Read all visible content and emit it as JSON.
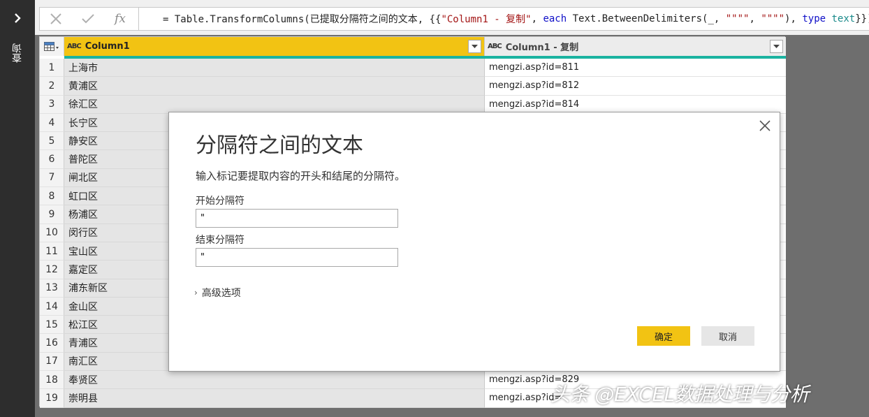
{
  "rail": {
    "label": "查询"
  },
  "formula": {
    "tokens": [
      {
        "t": "= Table.TransformColumns(已提取分隔符之间的文本, {{",
        "c": ""
      },
      {
        "t": "\"Column1 - 复制\"",
        "c": "str"
      },
      {
        "t": ", ",
        "c": ""
      },
      {
        "t": "each",
        "c": "kw"
      },
      {
        "t": " Text.BetweenDelimiters(_, ",
        "c": ""
      },
      {
        "t": "\"\"\"\"",
        "c": "str"
      },
      {
        "t": ", ",
        "c": ""
      },
      {
        "t": "\"\"\"\"",
        "c": "str"
      },
      {
        "t": "), ",
        "c": ""
      },
      {
        "t": "type",
        "c": "kw"
      },
      {
        "t": " ",
        "c": ""
      },
      {
        "t": "text",
        "c": "type"
      },
      {
        "t": "}})",
        "c": ""
      }
    ]
  },
  "grid": {
    "type_icon": "ABC",
    "columns": [
      "Column1",
      "Column1 - 复制"
    ],
    "rows": [
      {
        "n": "1",
        "c1": "上海市",
        "c2": "mengzi.asp?id=811"
      },
      {
        "n": "2",
        "c1": "黄浦区",
        "c2": "mengzi.asp?id=812"
      },
      {
        "n": "3",
        "c1": "徐汇区",
        "c2": "mengzi.asp?id=814"
      },
      {
        "n": "4",
        "c1": "长宁区",
        "c2": ""
      },
      {
        "n": "5",
        "c1": "静安区",
        "c2": ""
      },
      {
        "n": "6",
        "c1": "普陀区",
        "c2": ""
      },
      {
        "n": "7",
        "c1": "闸北区",
        "c2": ""
      },
      {
        "n": "8",
        "c1": "虹口区",
        "c2": ""
      },
      {
        "n": "9",
        "c1": "杨浦区",
        "c2": ""
      },
      {
        "n": "10",
        "c1": "闵行区",
        "c2": ""
      },
      {
        "n": "11",
        "c1": "宝山区",
        "c2": ""
      },
      {
        "n": "12",
        "c1": "嘉定区",
        "c2": ""
      },
      {
        "n": "13",
        "c1": "浦东新区",
        "c2": ""
      },
      {
        "n": "14",
        "c1": "金山区",
        "c2": ""
      },
      {
        "n": "15",
        "c1": "松江区",
        "c2": ""
      },
      {
        "n": "16",
        "c1": "青浦区",
        "c2": ""
      },
      {
        "n": "17",
        "c1": "南汇区",
        "c2": ""
      },
      {
        "n": "18",
        "c1": "奉贤区",
        "c2": "mengzi.asp?id=829"
      },
      {
        "n": "19",
        "c1": "崇明县",
        "c2": "mengzi.asp?id="
      }
    ]
  },
  "dialog": {
    "title": "分隔符之间的文本",
    "description": "输入标记要提取内容的开头和结尾的分隔符。",
    "start_label": "开始分隔符",
    "start_value": "\"",
    "end_label": "结束分隔符",
    "end_value": "\"",
    "advanced_label": "高级选项",
    "ok_label": "确定",
    "cancel_label": "取消"
  },
  "watermark": "头条 @EXCEL数据处理与分析",
  "colors": {
    "accent": "#f2c313",
    "teal": "#1bb3a0",
    "rail": "#2d2d2d"
  }
}
